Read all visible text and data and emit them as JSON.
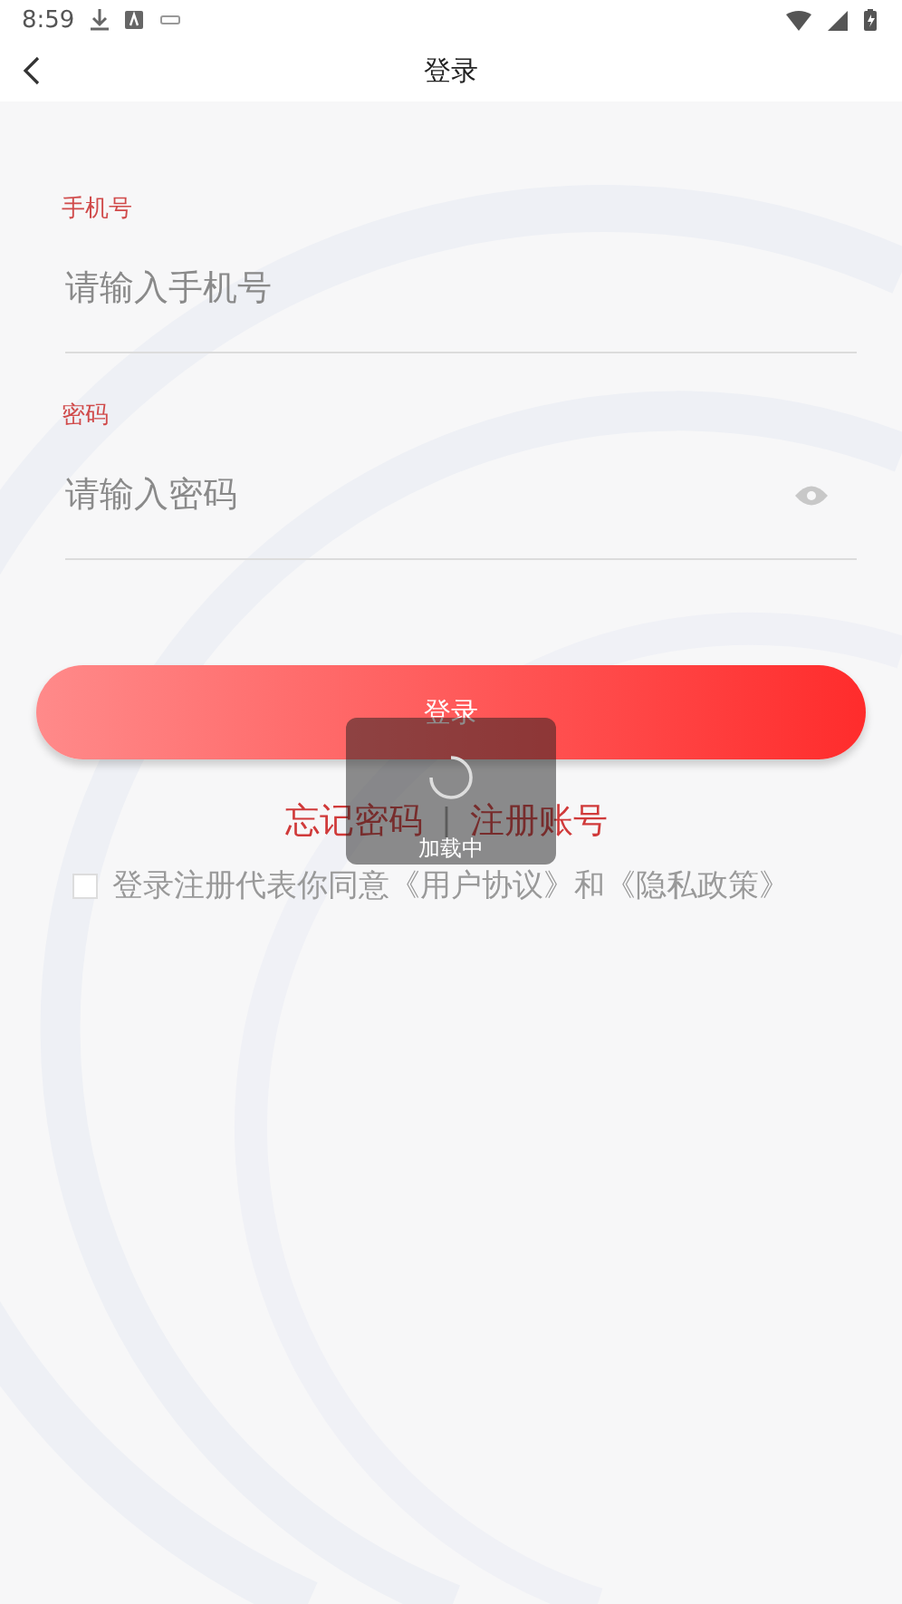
{
  "status_bar": {
    "time": "8:59"
  },
  "header": {
    "title": "登录"
  },
  "fields": [
    {
      "label": "手机号",
      "placeholder": "请输入手机号",
      "kind": "text"
    },
    {
      "label": "密码",
      "placeholder": "请输入密码",
      "kind": "password"
    }
  ],
  "login_button": "登录",
  "links": {
    "forgot": "忘记密码",
    "separator": "|",
    "register": "注册账号"
  },
  "agreement": {
    "checked": false,
    "text": "登录注册代表你同意《用户协议》和《隐私政策》"
  },
  "toast": {
    "text": "加载中"
  }
}
